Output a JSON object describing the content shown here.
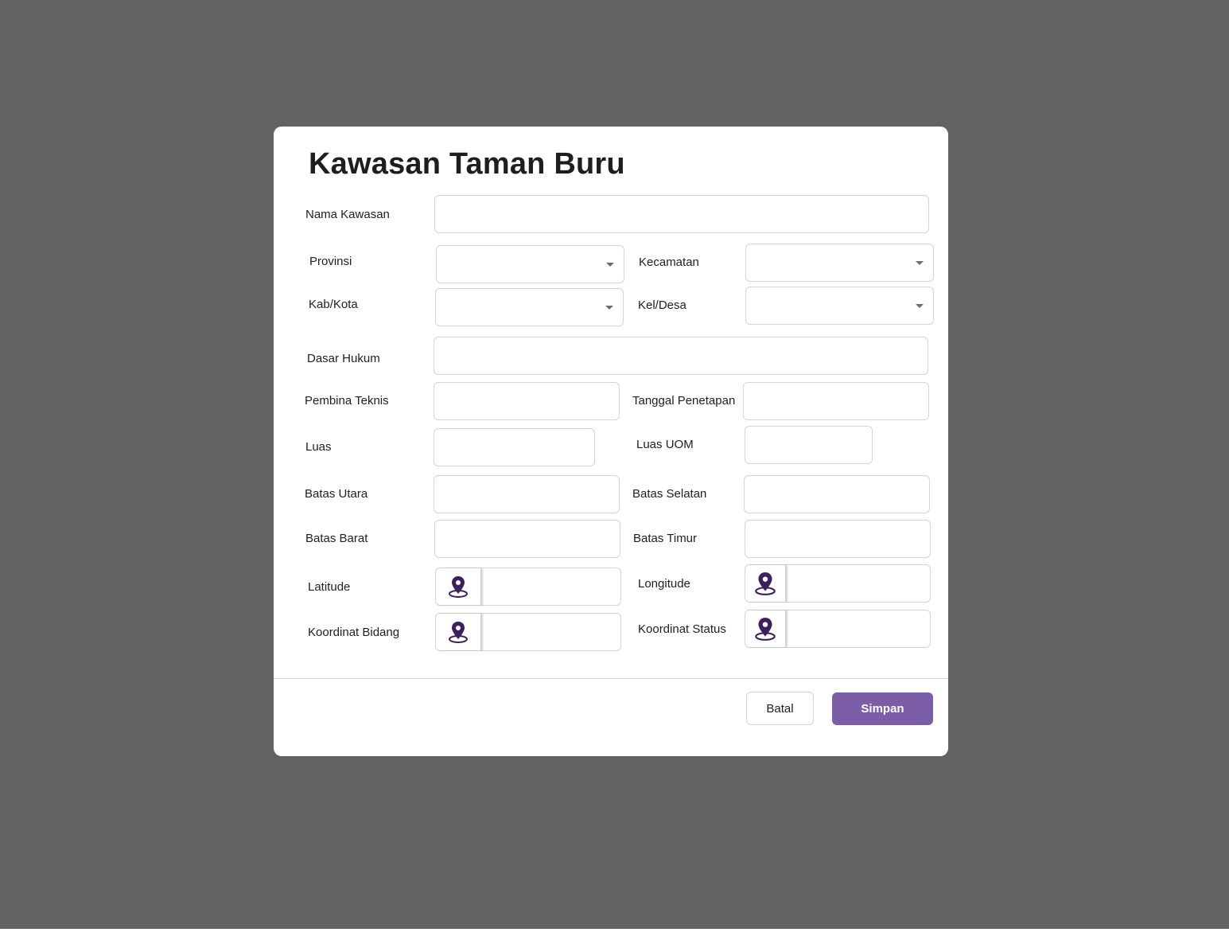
{
  "dialog": {
    "title": "Kawasan Taman Buru"
  },
  "fields": {
    "nama_kawasan": {
      "label": "Nama Kawasan",
      "value": ""
    },
    "provinsi": {
      "label": "Provinsi",
      "value": ""
    },
    "kecamatan": {
      "label": "Kecamatan",
      "value": ""
    },
    "kab_kota": {
      "label": "Kab/Kota",
      "value": ""
    },
    "kel_desa": {
      "label": "Kel/Desa",
      "value": ""
    },
    "dasar_hukum": {
      "label": "Dasar Hukum",
      "value": ""
    },
    "pembina_teknis": {
      "label": "Pembina Teknis",
      "value": ""
    },
    "tanggal_penetapan": {
      "label": "Tanggal Penetapan",
      "value": ""
    },
    "luas": {
      "label": "Luas",
      "value": ""
    },
    "luas_uom": {
      "label": "Luas UOM",
      "value": ""
    },
    "batas_utara": {
      "label": "Batas Utara",
      "value": ""
    },
    "batas_selatan": {
      "label": "Batas Selatan",
      "value": ""
    },
    "batas_barat": {
      "label": "Batas Barat",
      "value": ""
    },
    "batas_timur": {
      "label": "Batas Timur",
      "value": ""
    },
    "latitude": {
      "label": "Latitude",
      "value": "",
      "icon": "map-pin-icon"
    },
    "longitude": {
      "label": "Longitude",
      "value": "",
      "icon": "map-pin-icon"
    },
    "koordinat_bidang": {
      "label": "Koordinat Bidang",
      "value": "",
      "icon": "map-pin-icon"
    },
    "koordinat_status": {
      "label": "Koordinat Status",
      "value": "",
      "icon": "map-pin-icon"
    }
  },
  "actions": {
    "cancel_label": "Batal",
    "save_label": "Simpan"
  },
  "colors": {
    "overlay": "#626262",
    "primary": "#7b5ea7",
    "pin": "#3d1f5c"
  }
}
